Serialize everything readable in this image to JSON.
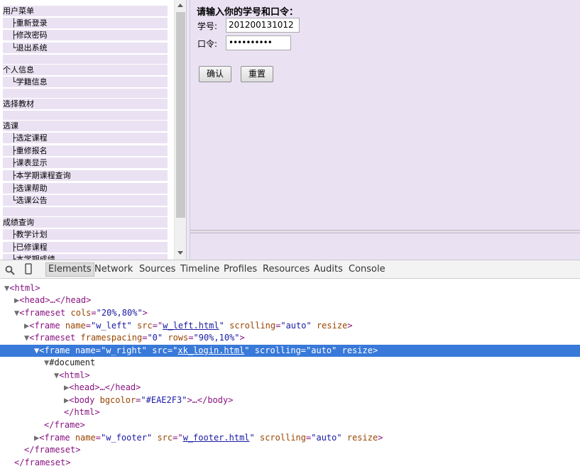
{
  "left_menu": {
    "rows": [
      {
        "label": "用户菜单",
        "sub": false
      },
      {
        "label": "├重新登录",
        "sub": true
      },
      {
        "label": "├修改密码",
        "sub": true
      },
      {
        "label": "└退出系统",
        "sub": true
      },
      {
        "label": "个人信息",
        "sub": false
      },
      {
        "label": "└学籍信息",
        "sub": true
      },
      {
        "label": "选择教材",
        "sub": false
      },
      {
        "label": "选课",
        "sub": false
      },
      {
        "label": "├选定课程",
        "sub": true
      },
      {
        "label": "├重修报名",
        "sub": true
      },
      {
        "label": "├课表显示",
        "sub": true
      },
      {
        "label": "├本学期课程查询",
        "sub": true
      },
      {
        "label": "├选课帮助",
        "sub": true
      },
      {
        "label": "└选课公告",
        "sub": true
      },
      {
        "label": "成绩查询",
        "sub": false
      },
      {
        "label": "├教学计划",
        "sub": true
      },
      {
        "label": "├已修课程",
        "sub": true
      },
      {
        "label": "├本学期成绩",
        "sub": true
      }
    ]
  },
  "login": {
    "title": "请输入你的学号和口令：",
    "student_id_label": "学号:",
    "student_id_value": "201200131012",
    "password_label": "口令:",
    "password_value": "••••••••••",
    "confirm_button": "确认",
    "reset_button": "重置"
  },
  "devtools": {
    "tabs": [
      "Elements",
      "Network",
      "Sources",
      "Timeline",
      "Profiles",
      "Resources",
      "Audits",
      "Console"
    ],
    "active_tab": "Elements",
    "tree": [
      {
        "tri": "▼",
        "tag_open": "<html>"
      },
      {
        "tri": "▶",
        "tag_open": "<head>…</head>"
      },
      {
        "tri": "▼",
        "tag_open": "<frameset",
        "attr1": "cols",
        "val1": "\"20%,80%\"",
        "tag_close": ">"
      },
      {
        "tri": "▶",
        "tag_open": "<frame",
        "attr1": "name",
        "val1": "\"w_left\"",
        "attr2": "src",
        "link": "w_left.html",
        "attr3": "scrolling",
        "val3": "\"auto\"",
        "attr4": "resize",
        "tag_close": ">"
      },
      {
        "tri": "▼",
        "tag_open": "<frameset",
        "attr1": "framespacing",
        "val1": "\"0\"",
        "attr2": "rows",
        "val2": "\"90%,10%\"",
        "tag_close": ">"
      },
      {
        "tri": "▼",
        "tag_open": "<frame",
        "attr1": "name",
        "val1": "\"w_right\"",
        "attr2": "src",
        "link": "xk_login.html",
        "attr3": "scrolling",
        "val3": "\"auto\"",
        "attr4": "resize",
        "tag_close": ">"
      },
      {
        "tri": "▼",
        "text": "#document"
      },
      {
        "tri": "▼",
        "tag_open": "<html>"
      },
      {
        "tri": "▶",
        "tag_open": "<head>…</head>"
      },
      {
        "tri": "▶",
        "tag_open": "<body",
        "attr1": "bgcolor",
        "val1": "\"#EAE2F3\"",
        "tag_close": ">…</body>"
      },
      {
        "tri": "",
        "tag_open": "</html>"
      },
      {
        "tri": "",
        "tag_open": "</frame>"
      },
      {
        "tri": "▶",
        "tag_open": "<frame",
        "attr1": "name",
        "val1": "\"w_footer\"",
        "attr2": "src",
        "link": "w_footer.html",
        "attr3": "scrolling",
        "val3": "\"auto\"",
        "attr4": "resize",
        "tag_close": ">"
      },
      {
        "tri": "",
        "tag_open": "</frameset>"
      },
      {
        "tri": "",
        "tag_open": "</frameset>"
      }
    ]
  },
  "colors": {
    "frame_bg": "#EAE2F3",
    "selection": "#3879d9"
  },
  "icons": [
    "search-icon",
    "device-icon"
  ]
}
